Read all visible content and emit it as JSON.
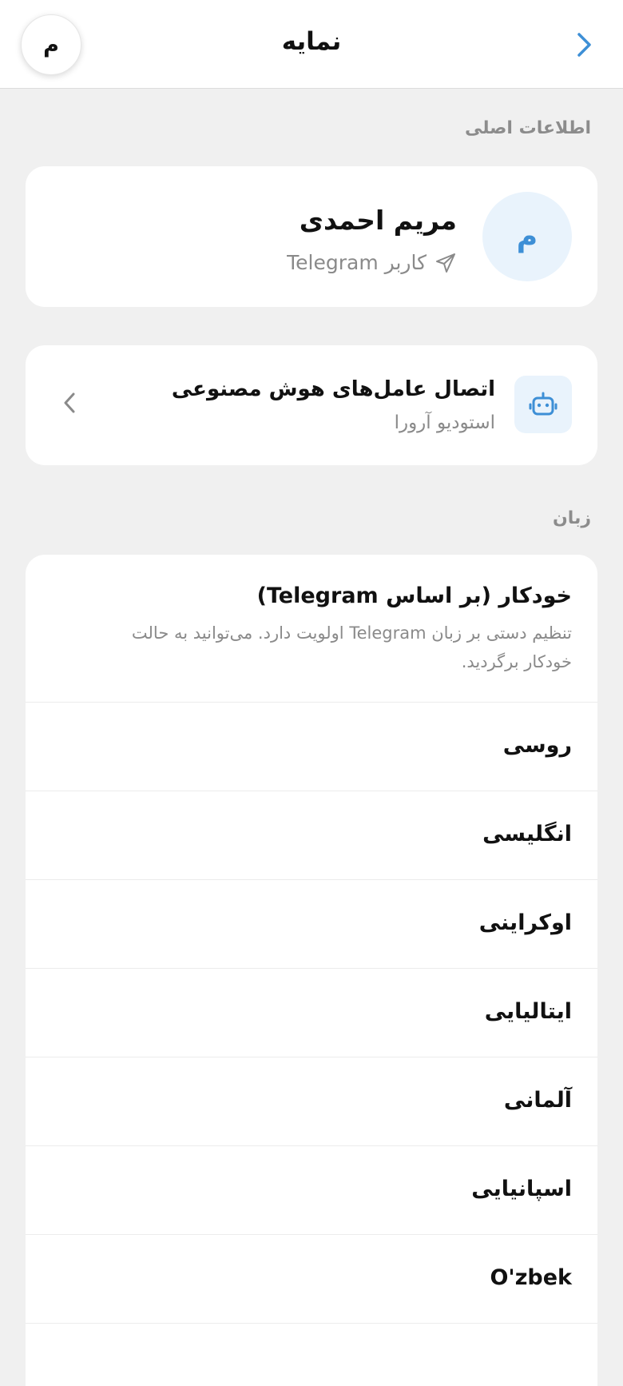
{
  "header": {
    "title": "نمایه",
    "avatar_initial": "م"
  },
  "main_info": {
    "section_label": "اطلاعات اصلی",
    "avatar_initial": "م",
    "name": "مریم احمدی",
    "subtitle": "کاربر Telegram"
  },
  "ai_agents": {
    "title": "اتصال عامل‌های هوش مصنوعی",
    "subtitle": "استودیو آرورا"
  },
  "language": {
    "section_label": "زبان",
    "auto_title": "خودکار (بر اساس Telegram)",
    "auto_description": "تنظیم دستی بر زبان Telegram اولویت دارد. می‌توانید به حالت خودکار برگردید.",
    "options": [
      {
        "label": "روسی"
      },
      {
        "label": "انگلیسی"
      },
      {
        "label": "اوکراینی"
      },
      {
        "label": "ایتالیایی"
      },
      {
        "label": "آلمانی"
      },
      {
        "label": "اسپانیایی"
      },
      {
        "label": "O'zbek"
      }
    ]
  },
  "colors": {
    "accent": "#3d8fd6",
    "background": "#f0f0f0",
    "card": "#ffffff",
    "muted_text": "#8a8a8a"
  }
}
